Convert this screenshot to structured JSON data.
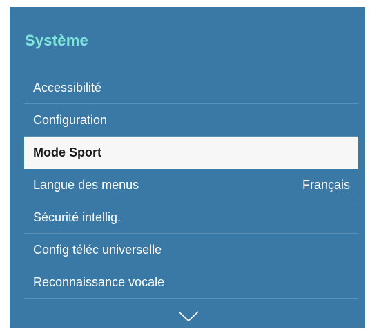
{
  "panel": {
    "title": "Système"
  },
  "menu": {
    "items": [
      {
        "label": "Accessibilité",
        "value": ""
      },
      {
        "label": "Configuration",
        "value": ""
      },
      {
        "label": "Mode Sport",
        "value": "",
        "selected": true
      },
      {
        "label": "Langue des menus",
        "value": "Français"
      },
      {
        "label": "Sécurité intellig.",
        "value": ""
      },
      {
        "label": "Config téléc universelle",
        "value": ""
      },
      {
        "label": "Reconnaissance vocale",
        "value": ""
      }
    ]
  },
  "icons": {
    "scroll_down": "chevron-down-icon"
  },
  "colors": {
    "panel_background": "#3a78a6",
    "title_color": "#7fe6dc",
    "selected_background": "#f7f7f7"
  }
}
